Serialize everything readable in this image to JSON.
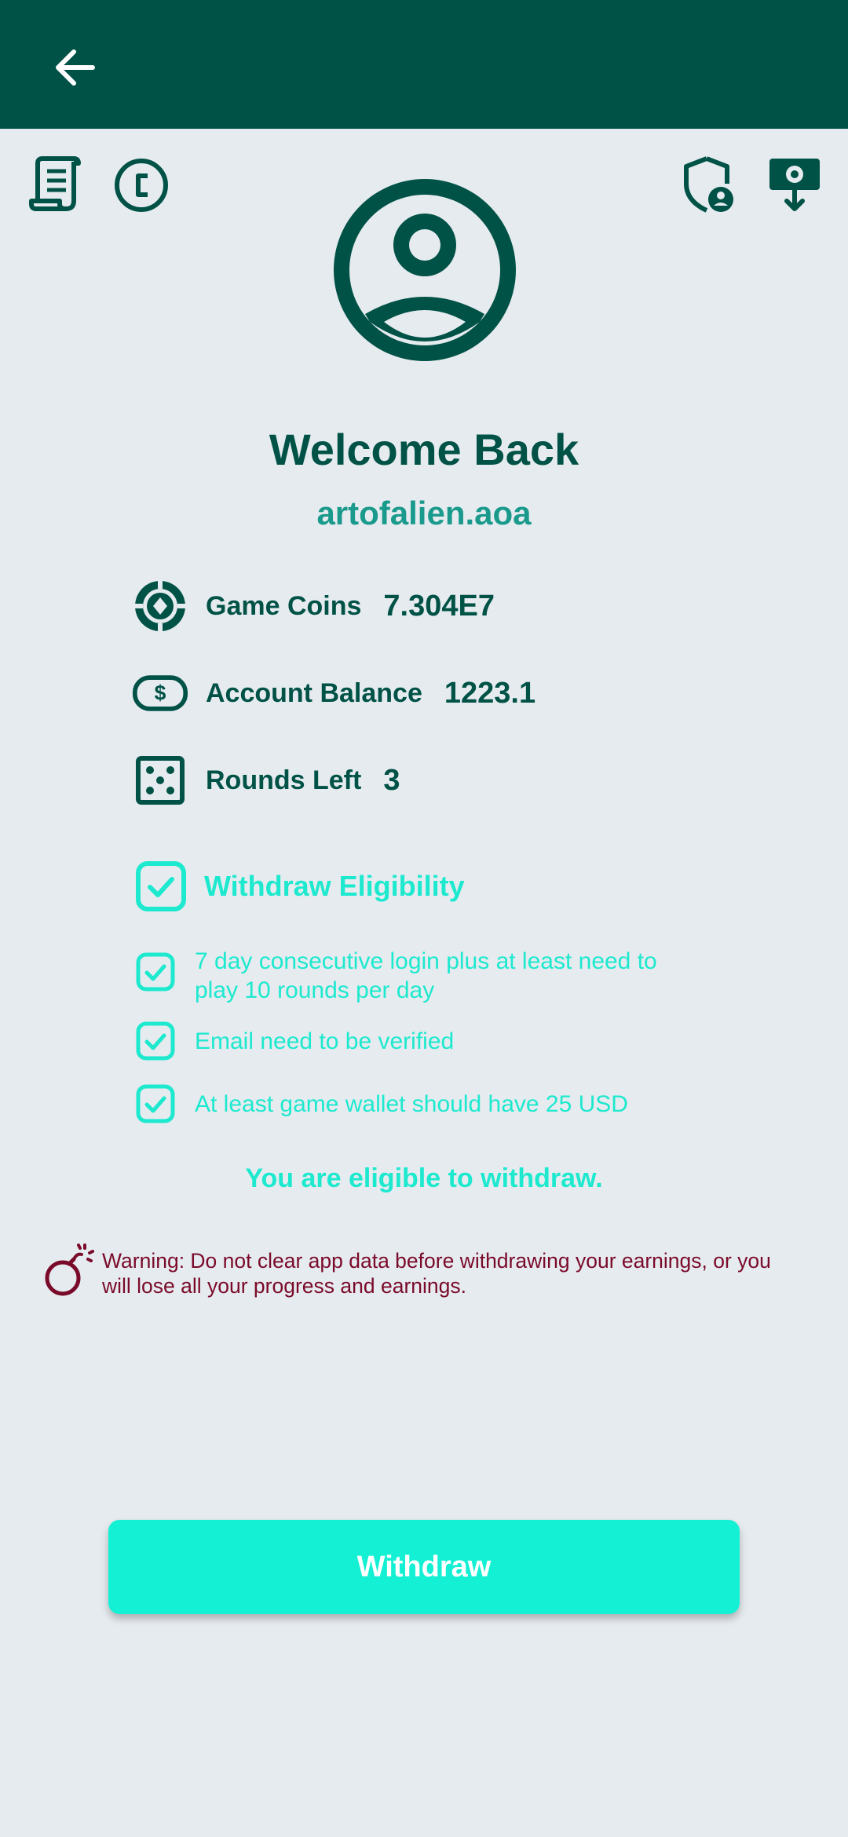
{
  "header": {
    "back_icon": "arrow-left-icon"
  },
  "toolbar": {
    "left_icons": [
      "receipt-icon",
      "coin-icon"
    ],
    "right_icons": [
      "shield-user-icon",
      "cash-download-icon"
    ]
  },
  "profile": {
    "avatar_icon": "account-circle-icon",
    "welcome": "Welcome Back",
    "username": "artofalien.aoa"
  },
  "stats": [
    {
      "icon": "poker-chip-icon",
      "label": "Game Coins",
      "value": "7.304E7"
    },
    {
      "icon": "cash-icon",
      "label": "Account Balance",
      "value": "1223.1"
    },
    {
      "icon": "dice-icon",
      "label": "Rounds Left",
      "value": "3"
    }
  ],
  "eligibility": {
    "title": "Withdraw Eligibility",
    "requirements": [
      "7 day consecutive login plus at least need to play 10 rounds per day",
      "Email need to be verified",
      "At least game wallet should have 25 USD"
    ],
    "status": "You are eligible to withdraw."
  },
  "warning": {
    "icon": "bomb-icon",
    "text": "Warning: Do not clear app data before withdrawing your earnings, or you will lose all your progress and earnings."
  },
  "actions": {
    "withdraw_label": "Withdraw"
  },
  "colors": {
    "appbar": "#005246",
    "primary_text": "#005246",
    "username": "#1a9a8c",
    "accent": "#1de9cf",
    "button": "#14f0d4",
    "warning": "#7a0a2a",
    "background": "#e6ebef"
  }
}
